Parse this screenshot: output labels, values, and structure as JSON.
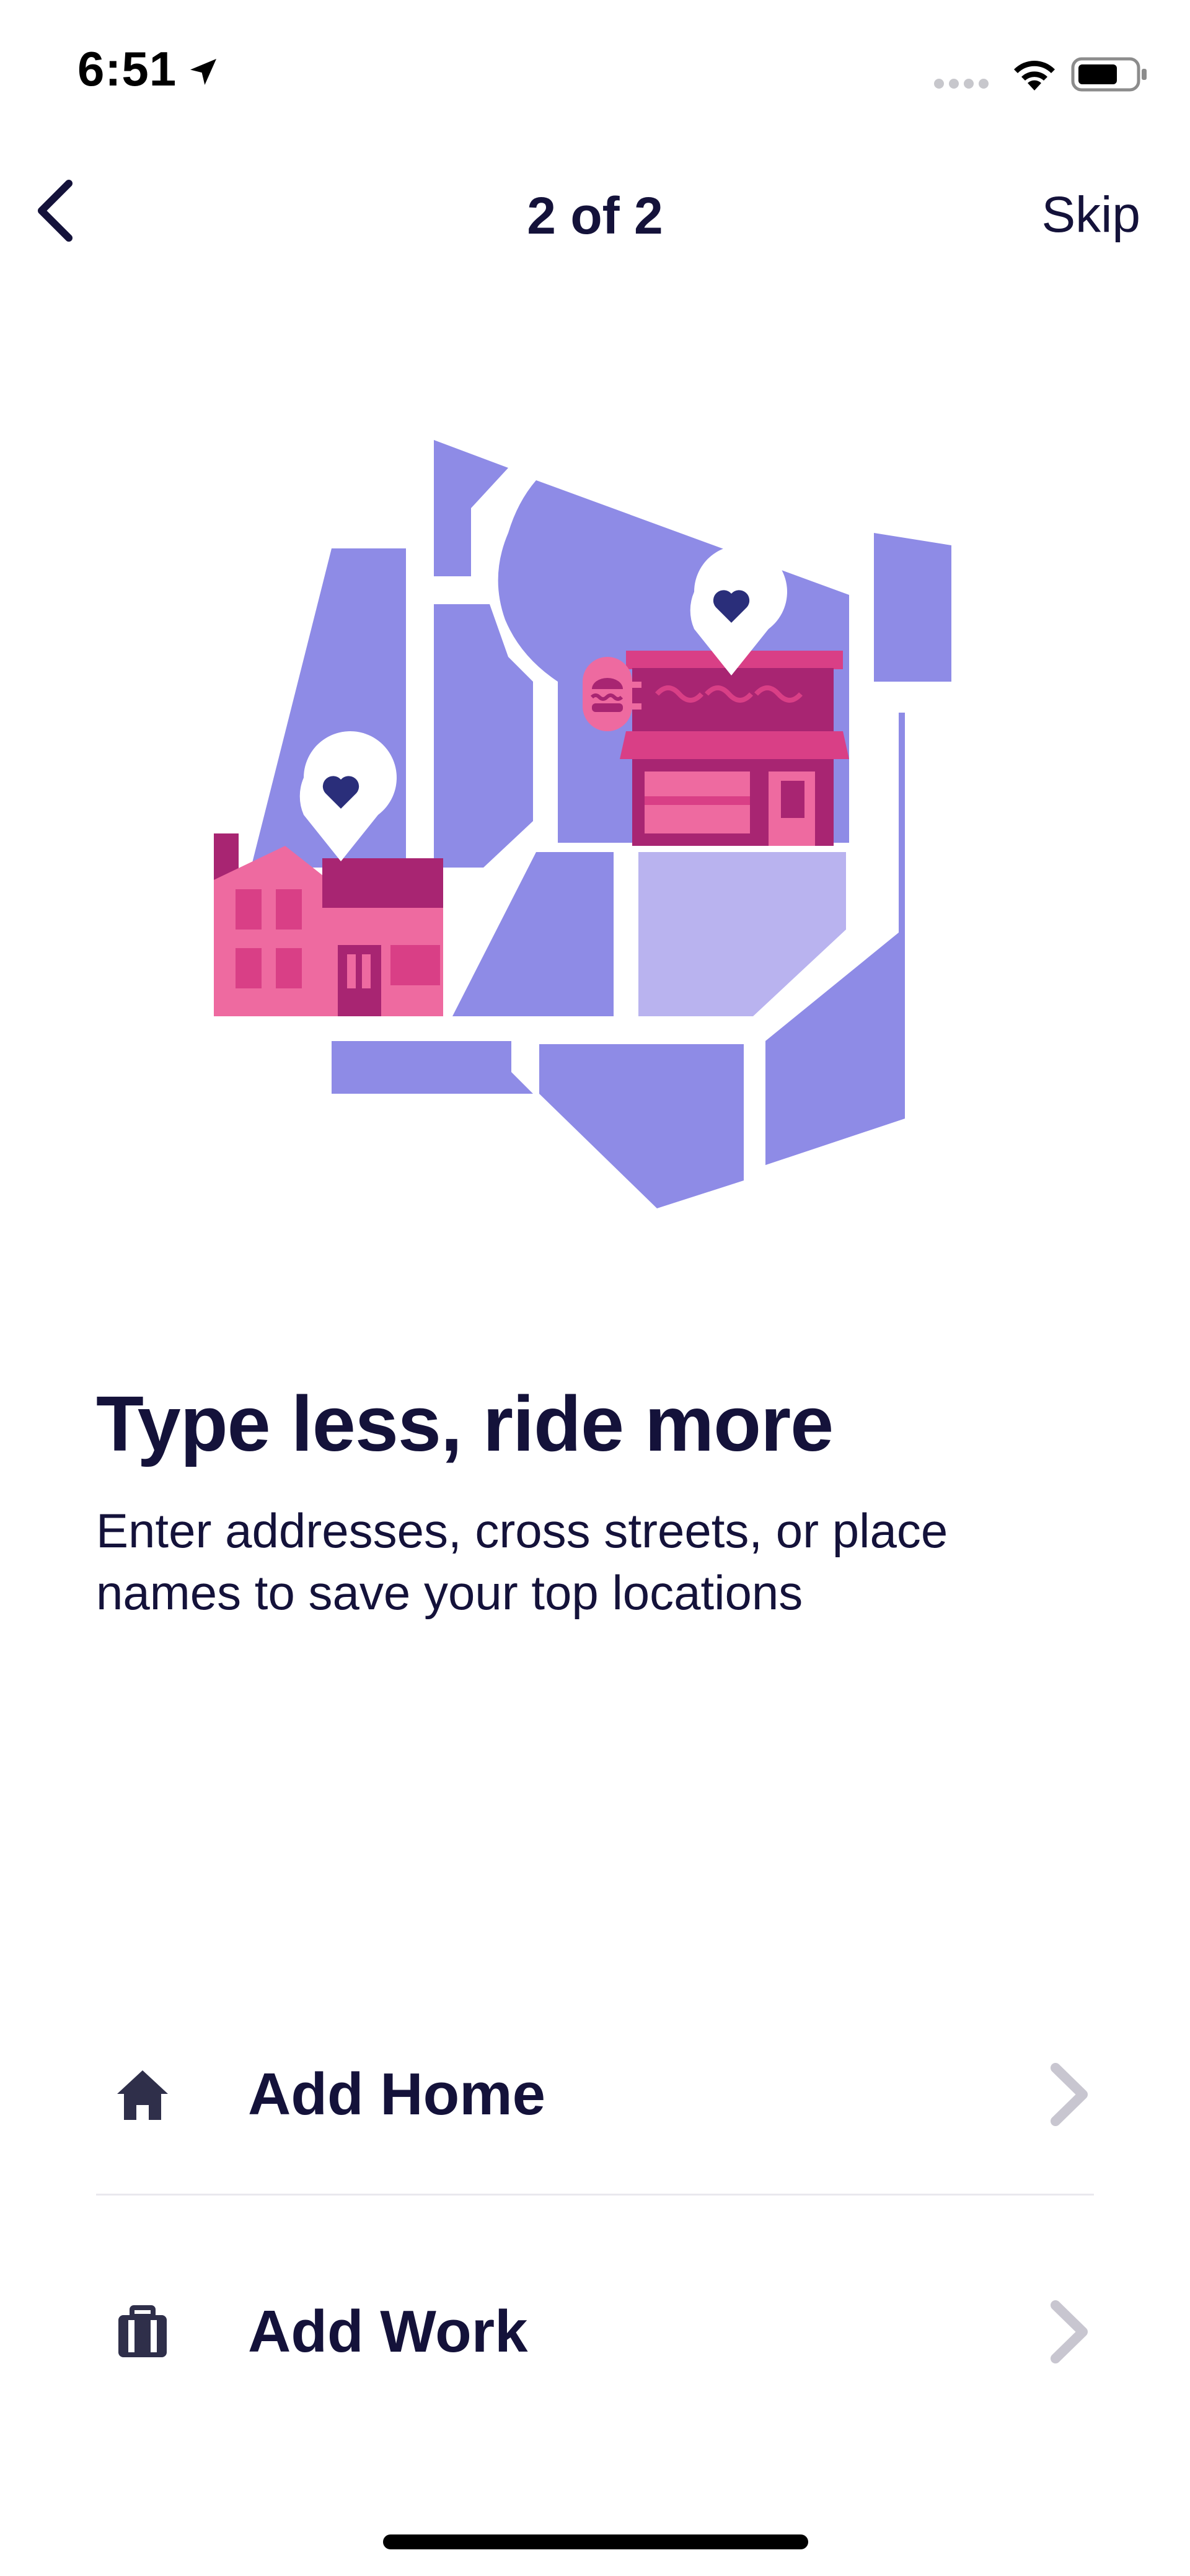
{
  "status_bar": {
    "time": "6:51",
    "icons": [
      "location-arrow-icon",
      "signal-dots-icon",
      "wifi-icon",
      "battery-icon"
    ]
  },
  "nav": {
    "back_icon": "chevron-left-icon",
    "page_indicator": "2 of 2",
    "skip_label": "Skip"
  },
  "content": {
    "headline": "Type less, ride more",
    "subtitle": "Enter addresses, cross streets, or place names to save your top locations"
  },
  "list": {
    "items": [
      {
        "label": "Add Home",
        "icon": "home-icon"
      },
      {
        "label": "Add Work",
        "icon": "briefcase-icon"
      }
    ]
  },
  "colors": {
    "text": "#14123a",
    "map_block": "#8e8be6",
    "map_block_light": "#b9b3ef",
    "pink": "#ee6aa0",
    "magenta": "#a82572",
    "pin_heart": "#2a2e7a",
    "chevron": "#c8c6d0"
  }
}
